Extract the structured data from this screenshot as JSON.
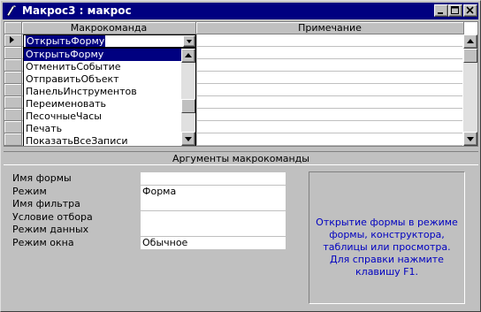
{
  "window": {
    "title": "Макрос3 : макрос"
  },
  "grid": {
    "columns": [
      "Макрокоманда",
      "Примечание"
    ],
    "current_value": "ОткрытьФорму"
  },
  "dropdown": {
    "options": [
      "ОткрытьФорму",
      "ОтменитьСобытие",
      "ОтправитьОбъект",
      "ПанельИнструментов",
      "Переименовать",
      "ПесочныеЧасы",
      "Печать",
      "ПоказатьВсеЗаписи"
    ],
    "selected_index": 0
  },
  "arguments": {
    "header": "Аргументы макрокоманды",
    "fields": [
      {
        "label": "Имя формы",
        "value": ""
      },
      {
        "label": "Режим",
        "value": "Форма"
      },
      {
        "label": "Имя фильтра",
        "value": ""
      },
      {
        "label": "Условие отбора",
        "value": ""
      },
      {
        "label": "Режим данных",
        "value": ""
      },
      {
        "label": "Режим окна",
        "value": "Обычное"
      }
    ]
  },
  "help": {
    "text": "Открытие формы в режиме формы, конструктора, таблицы или просмотра. Для справки нажмите клавишу F1."
  },
  "colors": {
    "titlebar": "#000080",
    "face": "#c0c0c0",
    "selection": "#000080",
    "help_text": "#0000c0"
  }
}
